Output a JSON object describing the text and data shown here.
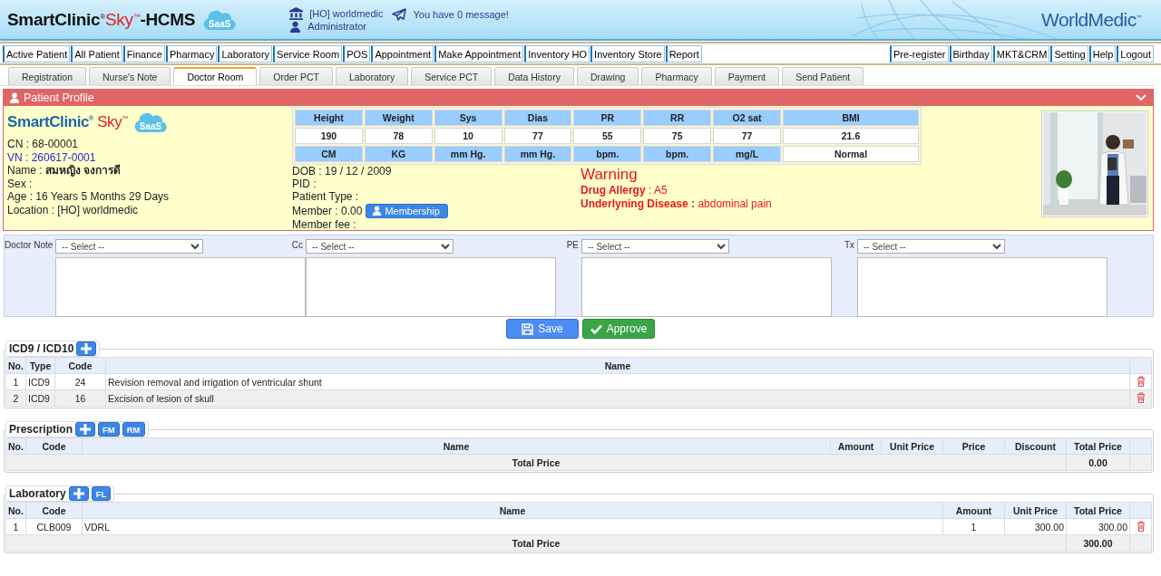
{
  "app": {
    "brand": "SmartClinic$^{®}$",
    "brand_accent": "Sky$^{™}$",
    "brand_suffix": "-HCMS",
    "cloud_badge": "SaaS",
    "branch": "[HO] worldmedic",
    "user": "Administrator",
    "message": "You have 0 message!",
    "vendor": "WorldMedic$^{™}$"
  },
  "main_menu": {
    "left": [
      "Active Patient",
      "All Patient",
      "Finance",
      "Pharmacy",
      "Laboratory",
      "Service Room",
      "POS",
      "Appointment",
      "Make Appointment",
      "Inventory HO",
      "Inventory Store",
      "Report"
    ],
    "right": [
      "Pre-register",
      "Birthday",
      "MKT&CRM",
      "Setting",
      "Help",
      "Logout"
    ]
  },
  "tabs": [
    {
      "label": "Registration",
      "selected": false
    },
    {
      "label": "Nurse's Note",
      "selected": false
    },
    {
      "label": "Doctor Room",
      "selected": true
    },
    {
      "label": "Order PCT",
      "selected": false
    },
    {
      "label": "Laboratory",
      "selected": false
    },
    {
      "label": "Service PCT",
      "selected": false
    },
    {
      "label": "Data History",
      "selected": false
    },
    {
      "label": "Drawing",
      "selected": false
    },
    {
      "label": "Pharmacy",
      "selected": false
    },
    {
      "label": "Payment",
      "selected": false
    },
    {
      "label": "Send Patient",
      "selected": false
    }
  ],
  "profile": {
    "title": "Patient Profile",
    "logo": {
      "brand": "SmartClinic$^{®}$",
      "accent": "Sky$^{™}$",
      "badge": "SaaS"
    },
    "info": [
      {
        "text": "CN : 68-00001",
        "kind": "text"
      },
      {
        "text": "VN : 260617-0001",
        "kind": "link"
      },
      {
        "text": "Name : **สมหญิง จงการดี**",
        "kind": "text"
      },
      {
        "text": "Sex :",
        "kind": "text"
      },
      {
        "text": "Age : 16 Years 5 Months 29 Days",
        "kind": "text"
      },
      {
        "text": "Location : [HO] worldmedic",
        "kind": "text"
      }
    ],
    "vitals": [
      {
        "name": "Height",
        "value": "190",
        "unit": "CM",
        "kind": "measure"
      },
      {
        "name": "Weight",
        "value": "78",
        "unit": "KG",
        "kind": "measure"
      },
      {
        "name": "Sys",
        "value": "10",
        "unit": "mm Hg.",
        "kind": "measure"
      },
      {
        "name": "Dias",
        "value": "77",
        "unit": "mm Hg.",
        "kind": "measure"
      },
      {
        "name": "PR",
        "value": "55",
        "unit": "bpm.",
        "kind": "measure"
      },
      {
        "name": "RR",
        "value": "75",
        "unit": "bpm.",
        "kind": "measure"
      },
      {
        "name": "O2 sat",
        "value": "77",
        "unit": "mg/L",
        "kind": "measure"
      },
      {
        "name": "BMI",
        "value": "21.6",
        "unit": "Normal",
        "kind": "index"
      }
    ],
    "details": [
      {
        "text": "DOB : 19 / 12 / 2009"
      },
      {
        "text": "PID :"
      },
      {
        "text": "Patient Type :"
      },
      {
        "text": "Member : 0.00",
        "action": "Membership"
      },
      {
        "text": "Member fee :"
      }
    ],
    "warning": {
      "title": "Warning",
      "lines": [
        "**Drug Allergy** : A5",
        "**Underlyning Disease :** abdominal pain"
      ]
    }
  },
  "notes": [
    {
      "label": "Doctor Note",
      "value": "-- Select --"
    },
    {
      "label": "Cc",
      "value": "-- Select --"
    },
    {
      "label": "PE",
      "value": "-- Select --"
    },
    {
      "label": "Tx",
      "value": "-- Select --"
    }
  ],
  "actions": [
    {
      "label": "Save",
      "kind": "save"
    },
    {
      "label": "Approve",
      "kind": "approve"
    }
  ],
  "sections": [
    {
      "title": "ICD9 / ICD10",
      "tools": [
        {
          "kind": "add"
        }
      ],
      "columns": [
        {
          "label": "No.",
          "kind": "index"
        },
        {
          "label": "Type",
          "kind": "text"
        },
        {
          "label": "Code",
          "kind": "code"
        },
        {
          "label": "Name",
          "kind": "text"
        }
      ],
      "rows": [
        {
          "cells": [
            "1",
            "ICD9",
            "24",
            "Revision removal and irrigation of ventricular shunt"
          ]
        },
        {
          "cells": [
            "2",
            "ICD9",
            "16",
            "Excision of lesion of skull"
          ]
        }
      ]
    },
    {
      "title": "Prescription",
      "tools": [
        {
          "kind": "add"
        },
        {
          "kind": "label",
          "label": "FM"
        },
        {
          "kind": "label",
          "label": "RM"
        }
      ],
      "columns": [
        {
          "label": "No."
        },
        {
          "label": "Code"
        },
        {
          "label": "Name"
        },
        {
          "label": "Amount"
        },
        {
          "label": "Unit Price"
        },
        {
          "label": "Price"
        },
        {
          "label": "Discount"
        },
        {
          "label": "Total Price"
        }
      ],
      "total": {
        "label": "Total Price",
        "value": "0.00"
      }
    },
    {
      "title": "Laboratory",
      "tools": [
        {
          "kind": "add"
        },
        {
          "kind": "label",
          "label": "FL"
        }
      ],
      "columns": [
        {
          "label": "No.",
          "kind": "index"
        },
        {
          "label": "Code",
          "kind": "code"
        },
        {
          "label": "Name",
          "kind": "text"
        },
        {
          "label": "Amount",
          "kind": "code"
        },
        {
          "label": "Unit Price",
          "kind": "money"
        },
        {
          "label": "Total Price",
          "kind": "money"
        }
      ],
      "rows": [
        {
          "cells": [
            "1",
            "CLB009",
            "VDRL",
            "1",
            "300.00",
            "300.00"
          ]
        }
      ],
      "total": {
        "label": "Total Price",
        "value": "300.00"
      }
    }
  ]
}
